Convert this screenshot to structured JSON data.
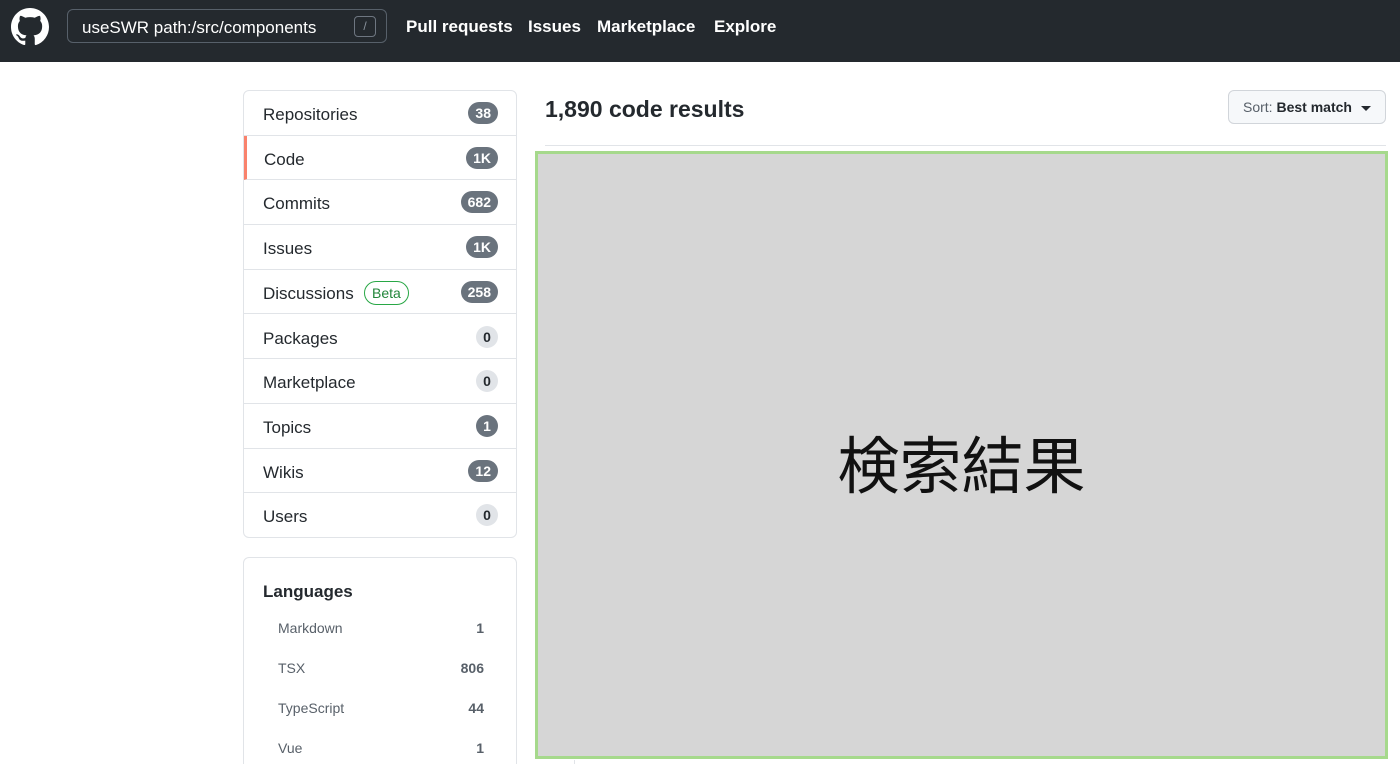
{
  "header": {
    "search_value": "useSWR path:/src/components",
    "search_shortcut": "/",
    "nav": [
      "Pull requests",
      "Issues",
      "Marketplace",
      "Explore"
    ]
  },
  "sidebar": {
    "items": [
      {
        "label": "Repositories",
        "count": "38"
      },
      {
        "label": "Code",
        "count": "1K"
      },
      {
        "label": "Commits",
        "count": "682"
      },
      {
        "label": "Issues",
        "count": "1K"
      },
      {
        "label": "Discussions",
        "badge": "Beta",
        "count": "258"
      },
      {
        "label": "Packages",
        "count": "0"
      },
      {
        "label": "Marketplace",
        "count": "0"
      },
      {
        "label": "Topics",
        "count": "1"
      },
      {
        "label": "Wikis",
        "count": "12"
      },
      {
        "label": "Users",
        "count": "0"
      }
    ],
    "selected": "Code"
  },
  "languages": {
    "title": "Languages",
    "items": [
      {
        "name": "Markdown",
        "count": "1"
      },
      {
        "name": "TSX",
        "count": "806"
      },
      {
        "name": "TypeScript",
        "count": "44"
      },
      {
        "name": "Vue",
        "count": "1"
      }
    ]
  },
  "main": {
    "results_title": "1,890 code results",
    "sort_prefix": "Sort:",
    "sort_value": "Best match",
    "placeholder_text": "検索結果"
  },
  "colors": {
    "header_bg": "#24292e",
    "selected_accent": "#f9826c",
    "beta_green": "#28a745",
    "placeholder_bg": "#d6d6d6",
    "placeholder_border": "#a6d98c"
  }
}
